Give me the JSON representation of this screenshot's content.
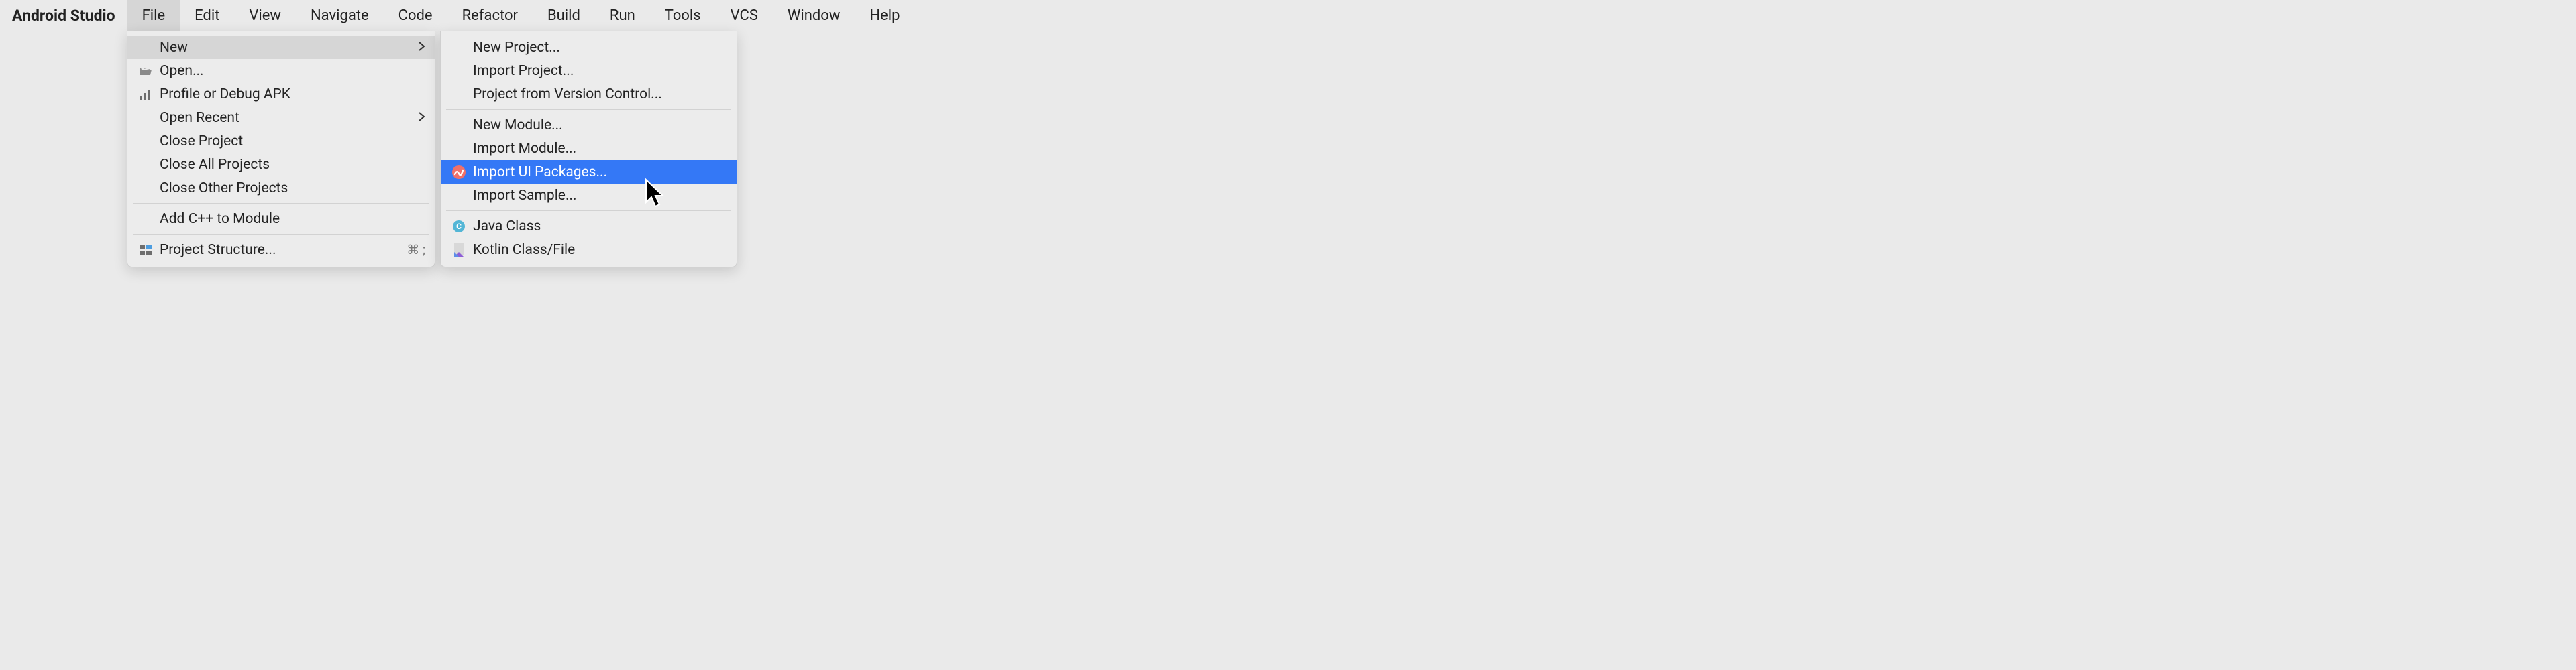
{
  "menubar": {
    "app": "Android Studio",
    "items": [
      "File",
      "Edit",
      "View",
      "Navigate",
      "Code",
      "Refactor",
      "Build",
      "Run",
      "Tools",
      "VCS",
      "Window",
      "Help"
    ]
  },
  "file_menu": {
    "new": "New",
    "open": "Open...",
    "profile": "Profile or Debug APK",
    "open_recent": "Open Recent",
    "close_project": "Close Project",
    "close_all": "Close All Projects",
    "close_other": "Close Other Projects",
    "add_cpp": "Add C++ to Module",
    "project_structure": "Project Structure...",
    "project_structure_shortcut": "⌘ ;"
  },
  "new_menu": {
    "new_project": "New Project...",
    "import_project": "Import Project...",
    "from_vcs": "Project from Version Control...",
    "new_module": "New Module...",
    "import_module": "Import Module...",
    "import_ui": "Import UI Packages...",
    "import_sample": "Import Sample...",
    "java_class": "Java Class",
    "kotlin_class": "Kotlin Class/File"
  }
}
